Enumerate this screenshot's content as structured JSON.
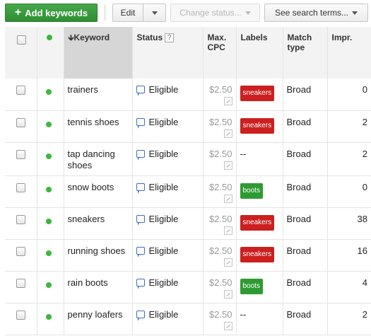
{
  "toolbar": {
    "add_label": "Add keywords",
    "edit_label": "Edit",
    "status_label": "Change status...",
    "terms_label": "See search terms..."
  },
  "table": {
    "headers": {
      "keyword": "Keyword",
      "status": "Status",
      "status_help": "?",
      "max_cpc": "Max. CPC",
      "labels": "Labels",
      "match_type": "Match type",
      "impr": "Impr."
    },
    "rows": [
      {
        "keyword": "trainers",
        "status": "Eligible",
        "max_cpc": "$2.50",
        "label": "sneakers",
        "label_color": "#cc1f1f",
        "match": "Broad",
        "impr": "0"
      },
      {
        "keyword": "tennis shoes",
        "status": "Eligible",
        "max_cpc": "$2.50",
        "label": "sneakers",
        "label_color": "#cc1f1f",
        "match": "Broad",
        "impr": "2"
      },
      {
        "keyword": "tap dancing shoes",
        "status": "Eligible",
        "max_cpc": "$2.50",
        "label": "--",
        "label_color": "",
        "match": "Broad",
        "impr": "2"
      },
      {
        "keyword": "snow boots",
        "status": "Eligible",
        "max_cpc": "$2.50",
        "label": "boots",
        "label_color": "#2e9b32",
        "match": "Broad",
        "impr": "0"
      },
      {
        "keyword": "sneakers",
        "status": "Eligible",
        "max_cpc": "$2.50",
        "label": "sneakers",
        "label_color": "#cc1f1f",
        "match": "Broad",
        "impr": "38"
      },
      {
        "keyword": "running shoes",
        "status": "Eligible",
        "max_cpc": "$2.50",
        "label": "sneakers",
        "label_color": "#cc1f1f",
        "match": "Broad",
        "impr": "16"
      },
      {
        "keyword": "rain boots",
        "status": "Eligible",
        "max_cpc": "$2.50",
        "label": "boots",
        "label_color": "#2e9b32",
        "match": "Broad",
        "impr": "4"
      },
      {
        "keyword": "penny loafers",
        "status": "Eligible",
        "max_cpc": "$2.50",
        "label": "--",
        "label_color": "",
        "match": "Broad",
        "impr": "2"
      }
    ]
  },
  "icons": {
    "add": "plus-icon",
    "dropdown": "chevron-down-icon",
    "status": "speech-bubble-icon",
    "graph": "bid-graph-icon",
    "enabled": "green-dot-icon"
  },
  "colors": {
    "accent_green": "#2f8e33",
    "label_red": "#cc1f1f",
    "label_green": "#2e9b32",
    "status_blue": "#3b6fc1"
  }
}
